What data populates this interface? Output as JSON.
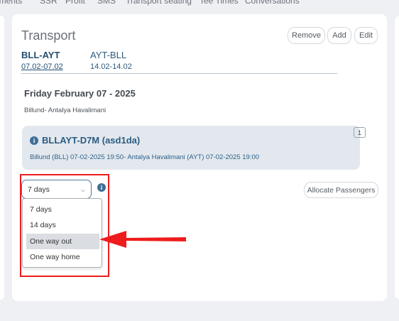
{
  "top_nav": [
    "nments",
    "SSR",
    "Profit",
    "SMS",
    "Transport seating",
    "Tee Times",
    "Conversations"
  ],
  "panel": {
    "title": "Transport",
    "actions": {
      "remove": "Remove",
      "add": "Add",
      "edit": "Edit"
    }
  },
  "tabs": [
    {
      "code": "BLL-AYT",
      "dates": "07.02-07.02",
      "active": true
    },
    {
      "code": "AYT-BLL",
      "dates": "14.02-14.02",
      "active": false
    }
  ],
  "day": {
    "heading": "Friday February 07 - 2025",
    "route": "Billund- Antalya Havalimani"
  },
  "flight": {
    "title": "BLLAYT-D7M (asd1da)",
    "detail": "Billund (BLL) 07-02-2025 19:50- Antalya Havalimani (AYT) 07-02-2025 19:00",
    "count": "1"
  },
  "duration_select": {
    "value": "7 days",
    "options": [
      "7 days",
      "14 days",
      "One way out",
      "One way home"
    ],
    "highlighted": "One way out"
  },
  "allocate_label": "Allocate Passengers",
  "colors": {
    "annotation_red": "#ee1c1c",
    "accent": "#2c5b82"
  },
  "icons": [
    "info-icon",
    "chevron-down-icon",
    "red-arrow-icon"
  ]
}
